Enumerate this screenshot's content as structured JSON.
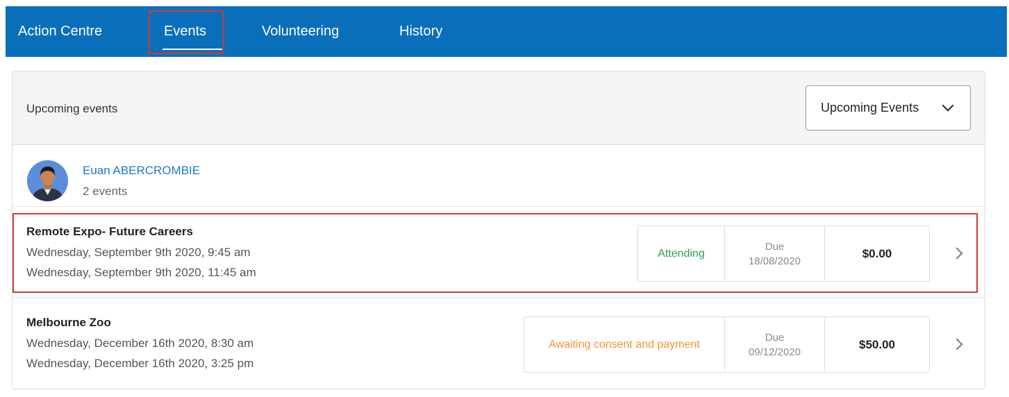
{
  "nav": {
    "tabs": [
      {
        "label": "Action Centre"
      },
      {
        "label": "Events"
      },
      {
        "label": "Volunteering"
      },
      {
        "label": "History"
      }
    ],
    "active_tab": "Events",
    "bar_color": "#0a6fba"
  },
  "card": {
    "title": "Upcoming events",
    "filter": {
      "selected": "Upcoming Events"
    }
  },
  "person": {
    "name": "Euan ABERCROMBIE",
    "event_count": "2 events"
  },
  "events": [
    {
      "title": "Remote Expo- Future Careers",
      "start": "Wednesday, September 9th 2020, 9:45 am",
      "end": "Wednesday, September 9th 2020, 11:45 am",
      "status": "Attending",
      "due_label": "Due",
      "due_date": "18/08/2020",
      "amount": "$0.00"
    },
    {
      "title": "Melbourne Zoo",
      "start": "Wednesday, December 16th 2020, 8:30 am",
      "end": "Wednesday, December 16th 2020, 3:25 pm",
      "status": "Awaiting consent and payment",
      "due_label": "Due",
      "due_date": "09/12/2020",
      "amount": "$50.00"
    }
  ],
  "colors": {
    "link": "#1f78c4",
    "attending": "#2e9e4f",
    "awaiting": "#f0932b",
    "highlight": "#d2392f"
  }
}
